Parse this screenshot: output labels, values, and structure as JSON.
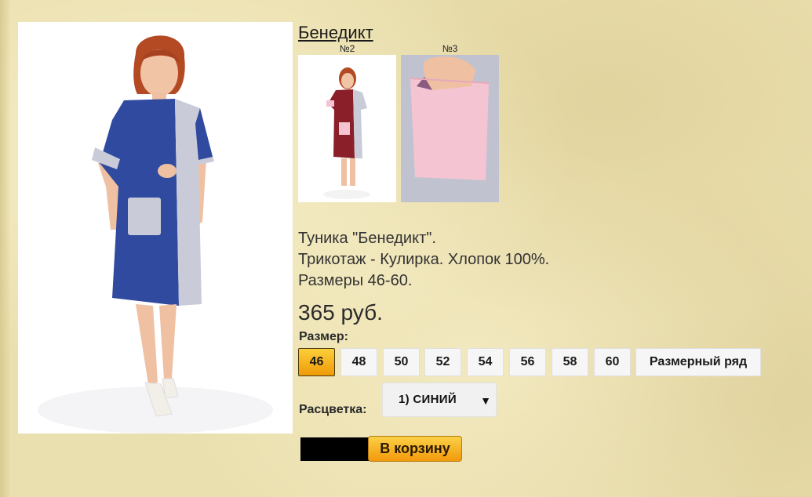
{
  "product": {
    "title": "Бенедикт",
    "thumbnails": [
      {
        "label": "№2",
        "alt": "dress-burgundy-photo"
      },
      {
        "label": "№3",
        "alt": "pocket-pink-photo"
      }
    ],
    "description": [
      "Туника \"Бенедикт\".",
      "Трикотаж - Кулирка. Хлопок 100%.",
      "Размеры 46-60."
    ],
    "price": "365 руб."
  },
  "size": {
    "label": "Размер:",
    "options": [
      "46",
      "48",
      "50",
      "52",
      "54",
      "56",
      "58",
      "60"
    ],
    "selected": "46",
    "chart_button": "Размерный ряд"
  },
  "color": {
    "label": "Расцветка:",
    "selected": "1) СИНИЙ"
  },
  "cart": {
    "button_label": "В корзину"
  },
  "colors": {
    "accent": "#f7b21e",
    "background": "#eadfae",
    "dress_blue": "#2f4a9e",
    "dress_grey": "#c9ccd8",
    "dress_burgundy": "#8a1f2a",
    "pocket_pink": "#f4c4d2"
  }
}
